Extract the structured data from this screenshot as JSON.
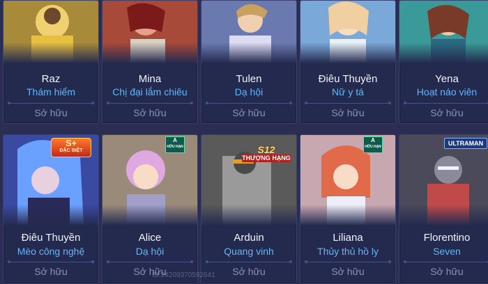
{
  "cards_row1": [
    {
      "name": "Raz",
      "skin": "Thám hiểm",
      "owned": "Sở hữu",
      "bg": "#a78a3a",
      "fg": "#f0d070"
    },
    {
      "name": "Mina",
      "skin": "Chị đại lắm chiêu",
      "owned": "Sở hữu",
      "bg": "#a84a3a",
      "fg": "#e7a08a"
    },
    {
      "name": "Tulen",
      "skin": "Dạ hội",
      "owned": "Sở hữu",
      "bg": "#6a7ab0",
      "fg": "#dcdcf2"
    },
    {
      "name": "Điêu Thuyền",
      "skin": "Nữ y tá",
      "owned": "Sở hữu",
      "bg": "#7aa8d8",
      "fg": "#f0d0a0"
    },
    {
      "name": "Yena",
      "skin": "Hoạt náo viên",
      "owned": "Sở hữu",
      "bg": "#3a9a98",
      "fg": "#f0c8a0"
    }
  ],
  "cards_row2": [
    {
      "name": "Điêu Thuyền",
      "skin": "Mèo công nghệ",
      "owned": "Sở hữu",
      "bg": "#3a4aa0",
      "fg": "#6aa0ff",
      "badge": {
        "type": "sp",
        "line1": "S+",
        "line2": "ĐẶC BIỆT"
      }
    },
    {
      "name": "Alice",
      "skin": "Dạ hội",
      "owned": "Sở hữu",
      "bg": "#9a8a7a",
      "fg": "#e0a8e0",
      "badge": {
        "type": "a",
        "line1": "A",
        "line2": "HỮU HẠN"
      }
    },
    {
      "name": "Arduin",
      "skin": "Quang vinh",
      "owned": "Sở hữu",
      "bg": "#6a6a6a",
      "fg": "#c0c0c0",
      "badge": {
        "type": "s12",
        "line1": "S12",
        "line2": "THƯỢNG HẠNG"
      }
    },
    {
      "name": "Liliana",
      "skin": "Thủy thủ hồ ly",
      "owned": "Sở hữu",
      "bg": "#c8a8b0",
      "fg": "#e06a4a",
      "badge": {
        "type": "a",
        "line1": "A",
        "line2": "HỮU HẠN"
      }
    },
    {
      "name": "Florentino",
      "skin": "Seven",
      "owned": "Sở hữu",
      "bg": "#4a4a5a",
      "fg": "#c04a4a",
      "badge": {
        "type": "ultra",
        "line1": "ULTRAMAN"
      }
    }
  ],
  "watermark": "ID:24209370592641"
}
